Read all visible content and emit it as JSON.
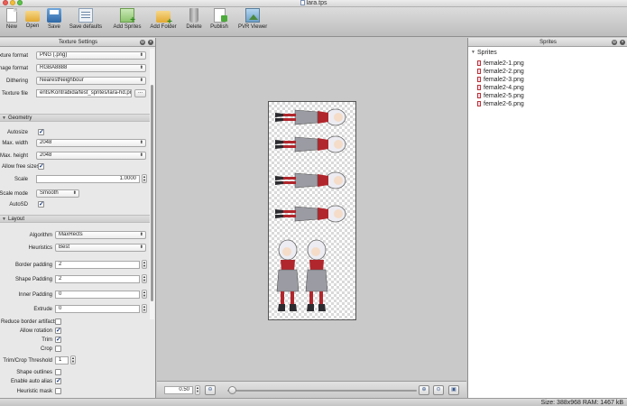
{
  "window": {
    "title": "lara.tps"
  },
  "toolbar": {
    "new": "New",
    "open": "Open",
    "save": "Save",
    "save_defaults": "Save defaults",
    "add_sprites": "Add Sprites",
    "add_folder": "Add Folder",
    "delete": "Delete",
    "publish": "Publish",
    "pvr_viewer": "PVR Viewer"
  },
  "settings": {
    "title": "Texture Settings",
    "texture_format": {
      "label": "Texture format",
      "value": "PNG (.png)"
    },
    "image_format": {
      "label": "Image format",
      "value": "RGBA8888"
    },
    "dithering": {
      "label": "Dithering",
      "value": "NearestNeighbour"
    },
    "texture_file": {
      "label": "Texture file",
      "value": "ents/Kontrabida/test_sprites/lara-hd.png",
      "button": "..."
    },
    "geometry": {
      "title": "Geometry",
      "autosize": {
        "label": "Autosize",
        "checked": true
      },
      "max_width": {
        "label": "Max. width",
        "value": "2048"
      },
      "max_height": {
        "label": "Max. height",
        "value": "2048"
      },
      "allow_free_sizes": {
        "label": "Allow free sizes",
        "checked": true
      },
      "scale": {
        "label": "Scale",
        "value": "1.0000"
      },
      "scale_mode": {
        "label": "Scale mode",
        "value": "Smooth"
      },
      "autosd": {
        "label": "AutoSD",
        "checked": true
      }
    },
    "layout": {
      "title": "Layout",
      "algorithm": {
        "label": "Algorithm",
        "value": "MaxRects"
      },
      "heuristics": {
        "label": "Heuristics",
        "value": "Best"
      },
      "border_padding": {
        "label": "Border padding",
        "value": "2"
      },
      "shape_padding": {
        "label": "Shape Padding",
        "value": "2"
      },
      "inner_padding": {
        "label": "Inner Padding",
        "value": "0"
      },
      "extrude": {
        "label": "Extrude",
        "value": "0"
      },
      "reduce_border_artifacts": {
        "label": "Reduce border artifacts",
        "checked": false
      },
      "allow_rotation": {
        "label": "Allow rotation",
        "checked": true
      },
      "trim": {
        "label": "Trim",
        "checked": true
      },
      "crop": {
        "label": "Crop",
        "checked": false
      },
      "trim_crop_threshold": {
        "label": "Trim/Crop Threshold",
        "value": "1"
      },
      "shape_outlines": {
        "label": "Shape outlines",
        "checked": false
      },
      "enable_auto_alias": {
        "label": "Enable auto alias",
        "checked": true
      },
      "heuristic_mask": {
        "label": "Heuristic mask",
        "checked": false
      }
    }
  },
  "preview": {
    "zoom": "0.50",
    "zoom_fraction": 0.03
  },
  "sprites": {
    "title": "Sprites",
    "root": "Sprites",
    "items": [
      "female2-1.png",
      "female2-2.png",
      "female2-3.png",
      "female2-4.png",
      "female2-5.png",
      "female2-6.png"
    ]
  },
  "status": {
    "text": "Size: 388x968 RAM: 1467 kB"
  },
  "colors": {
    "accent": "#1e3e80",
    "sprite_red": "#b0262c",
    "sprite_grey": "#9b9ba3"
  }
}
